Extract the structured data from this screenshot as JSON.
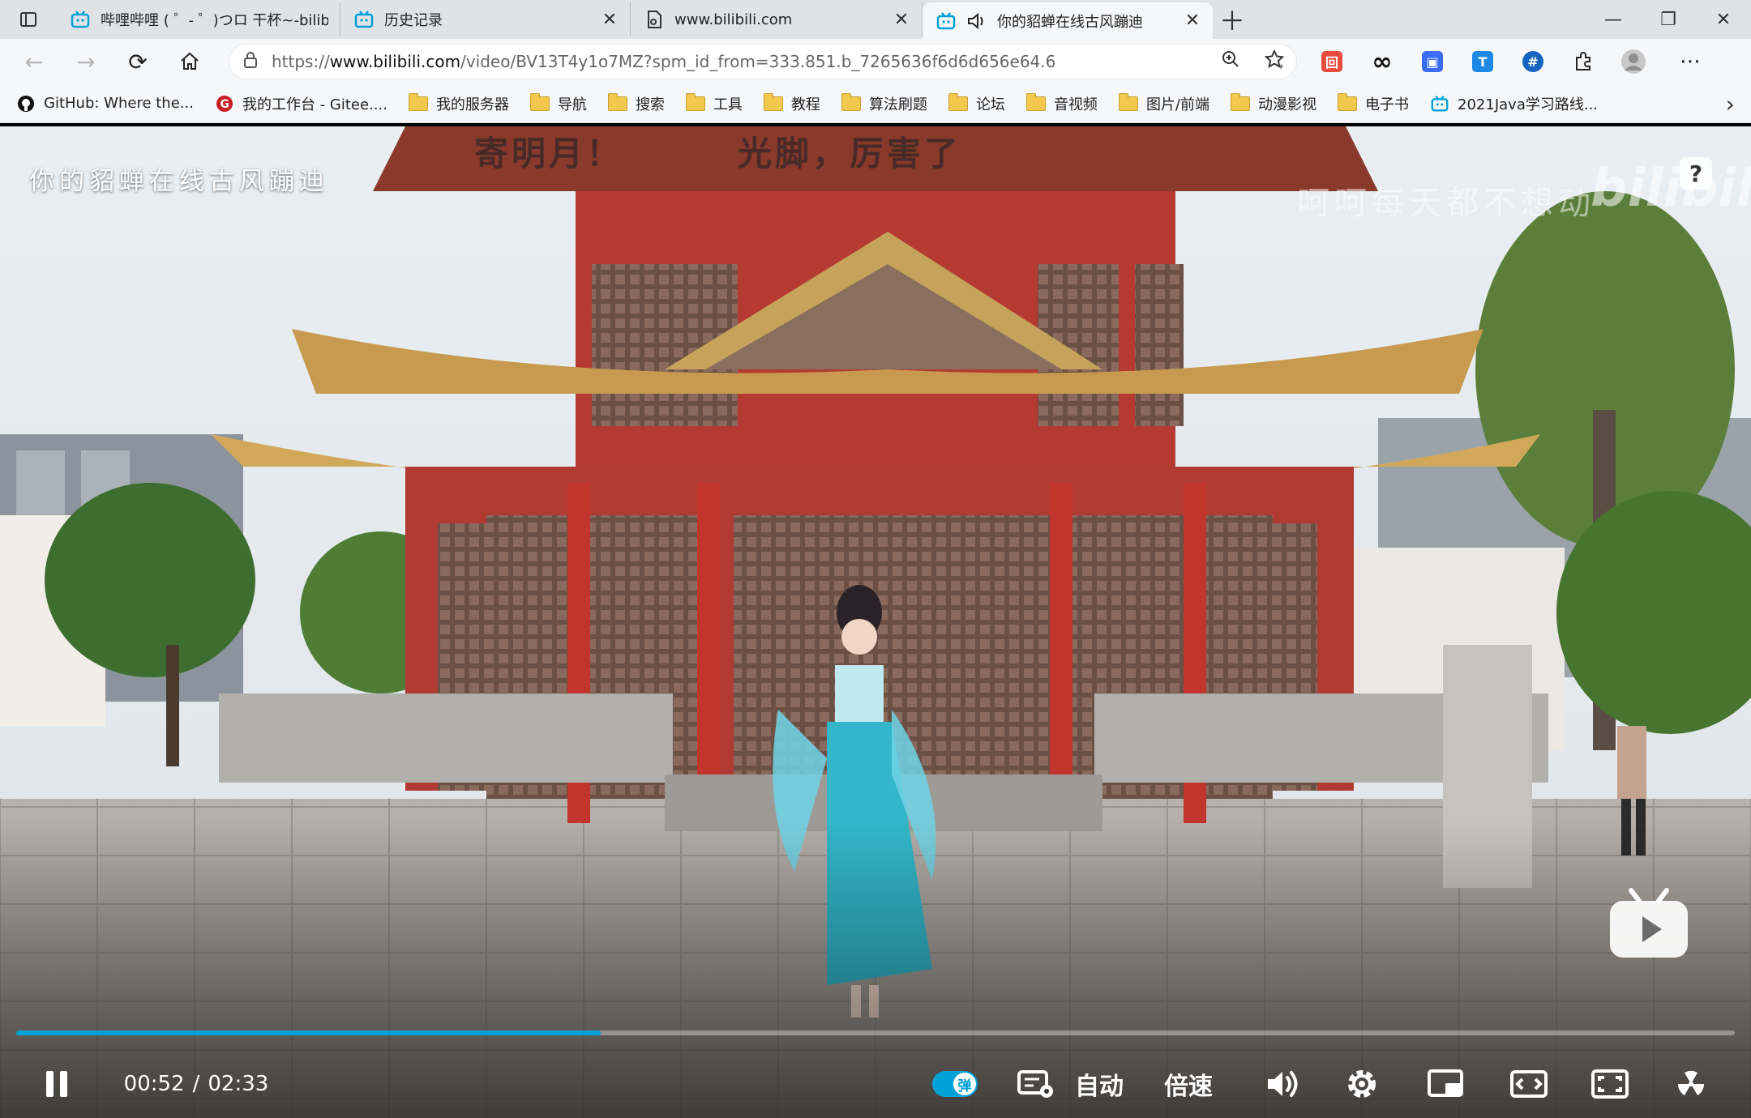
{
  "tabs": [
    {
      "title": "哔哩哔哩 ( ゜- ゜)つロ 干杯~-bilibili",
      "icon": "bilibili-tv-icon",
      "active": false
    },
    {
      "title": "历史记录",
      "icon": "bilibili-tv-icon",
      "active": false
    },
    {
      "title": "www.bilibili.com",
      "icon": "page-icon",
      "active": false
    },
    {
      "title": "你的貂蝉在线古风蹦迪",
      "icon": "bilibili-tv-icon",
      "active": true,
      "audio": true
    }
  ],
  "address": {
    "host_prefix": "https://",
    "host": "www.bilibili.com",
    "path": "/video/BV13T4y1o7MZ?spm_id_from=333.851.b_7265636f6d6d656e64.6"
  },
  "bookmarks": [
    {
      "label": "GitHub: Where the...",
      "icon": "github-icon"
    },
    {
      "label": "我的工作台 - Gitee....",
      "icon": "gitee-icon"
    },
    {
      "label": "我的服务器",
      "icon": "folder-icon"
    },
    {
      "label": "导航",
      "icon": "folder-icon"
    },
    {
      "label": "搜索",
      "icon": "folder-icon"
    },
    {
      "label": "工具",
      "icon": "folder-icon"
    },
    {
      "label": "教程",
      "icon": "folder-icon"
    },
    {
      "label": "算法刷题",
      "icon": "folder-icon"
    },
    {
      "label": "论坛",
      "icon": "folder-icon"
    },
    {
      "label": "音视频",
      "icon": "folder-icon"
    },
    {
      "label": "图片/前端",
      "icon": "folder-icon"
    },
    {
      "label": "动漫影视",
      "icon": "folder-icon"
    },
    {
      "label": "电子书",
      "icon": "folder-icon"
    },
    {
      "label": "2021Java学习路线...",
      "icon": "bilibili-tv-icon"
    }
  ],
  "video": {
    "title": "你的貂蝉在线古风蹦迪",
    "subtitle_left": "寄明月！",
    "subtitle_right": "光脚，厉害了",
    "watermark": "呵呵每天都不想动",
    "logo": "bilibili",
    "help": "?"
  },
  "player": {
    "current_time": "00:52",
    "separator": "/",
    "duration": "02:33",
    "progress_fraction": 0.34,
    "danmaku_label": "弹",
    "quality_label": "自动",
    "speed_label": "倍速",
    "accent_color": "#00a1d6"
  }
}
